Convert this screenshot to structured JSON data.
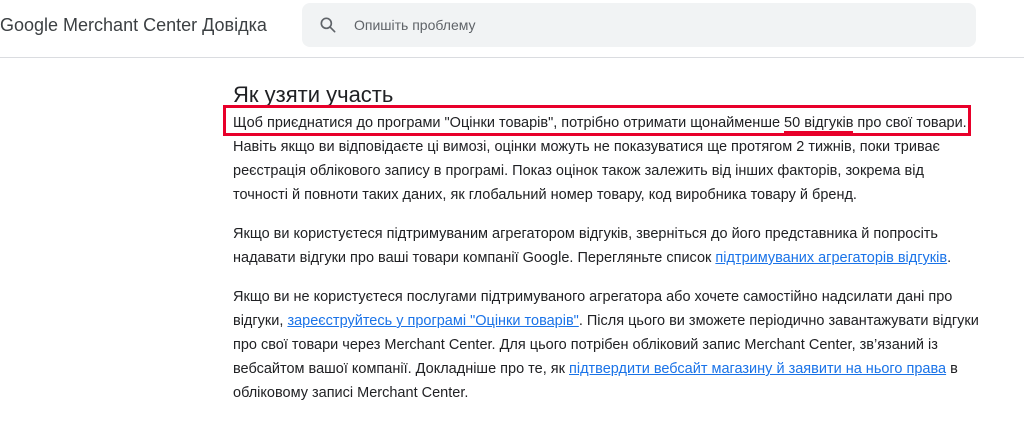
{
  "header": {
    "brand": "Google Merchant Center Довідка",
    "search_placeholder": "Опишіть проблему",
    "search_value": ""
  },
  "main": {
    "title": "Як узяти участь",
    "p1": {
      "before": "Щоб приєднатися до програми \"Оцінки товарів\", потрібно отримати щонайменше ",
      "highlight": "50 відгуків",
      "after": " про свої товари. Навіть якщо ви відповідаєте ці вимозі, оцінки можуть не показуватися ще протягом 2 тижнів, поки триває реєстрація облікового запису в програмі. Показ оцінок також залежить від інших факторів, зокрема від точності й повноти таких даних, як глобальний номер товару, код виробника товару й бренд."
    },
    "p2": {
      "text": "Якщо ви користуєтеся підтримуваним агрегатором відгуків, зверніться до його представника й попросіть надавати відгуки про ваші товари компанії Google. Перегляньте список ",
      "link": "підтримуваних агрегаторів відгуків",
      "end": "."
    },
    "p3": {
      "text1": "Якщо ви не користуєтеся послугами підтримуваного агрегатора або хочете самостійно надсилати дані про відгуки, ",
      "link1": "зареєструйтесь у програмі \"Оцінки товарів\"",
      "text2": ". Після цього ви зможете періодично завантажувати відгуки про свої товари через Merchant Center. Для цього потрібен обліковий запис Merchant Center, зв’язаний із вебсайтом вашої компанії. Докладніше про те, як ",
      "link2": "підтвердити вебсайт магазину й заявити на нього права",
      "text3": " в обліковому записі Merchant Center."
    }
  },
  "colors": {
    "annotation": "#e8002a",
    "link": "#1a73e8"
  },
  "icons": {
    "search": "search-icon"
  }
}
